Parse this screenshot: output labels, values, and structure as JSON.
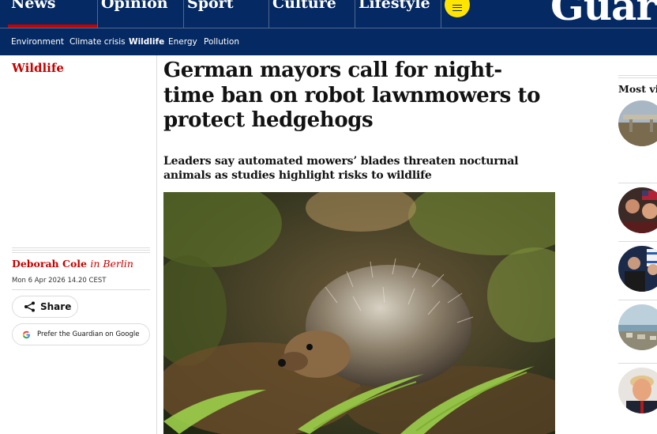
{
  "masthead": {
    "pillars": [
      {
        "label": "News"
      },
      {
        "label": "Opinion"
      },
      {
        "label": "Sport"
      },
      {
        "label": "Culture"
      },
      {
        "label": "Lifestyle"
      }
    ],
    "logo": "Guar",
    "colors": {
      "brand": "#052962",
      "news_accent": "#c70000",
      "menu": "#ffe500"
    }
  },
  "subnav": {
    "items": [
      {
        "label": "Environment"
      },
      {
        "label": "Climate crisis"
      },
      {
        "label": "Wildlife",
        "active": true
      },
      {
        "label": "Energy"
      },
      {
        "label": "Pollution"
      }
    ]
  },
  "article": {
    "section": "Wildlife",
    "headline": "German mayors call for night-time ban on robot lawnmowers to protect hedgehogs",
    "standfirst": "Leaders say automated mowers’ blades threaten nocturnal animals as studies highlight risks to wildlife",
    "author": "Deborah Cole",
    "location": "in Berlin",
    "date": "Mon 6 Apr 2026 14.20 CEST",
    "share_label": "Share",
    "google_label": "Prefer the Guardian on Google",
    "hero_image": "hedgehog-photo"
  },
  "rail": {
    "title": "Most viewed",
    "thumbs": [
      "bridge-thumb",
      "crowd-thumb",
      "leaders-thumb",
      "coast-thumb",
      "trump-thumb"
    ]
  }
}
